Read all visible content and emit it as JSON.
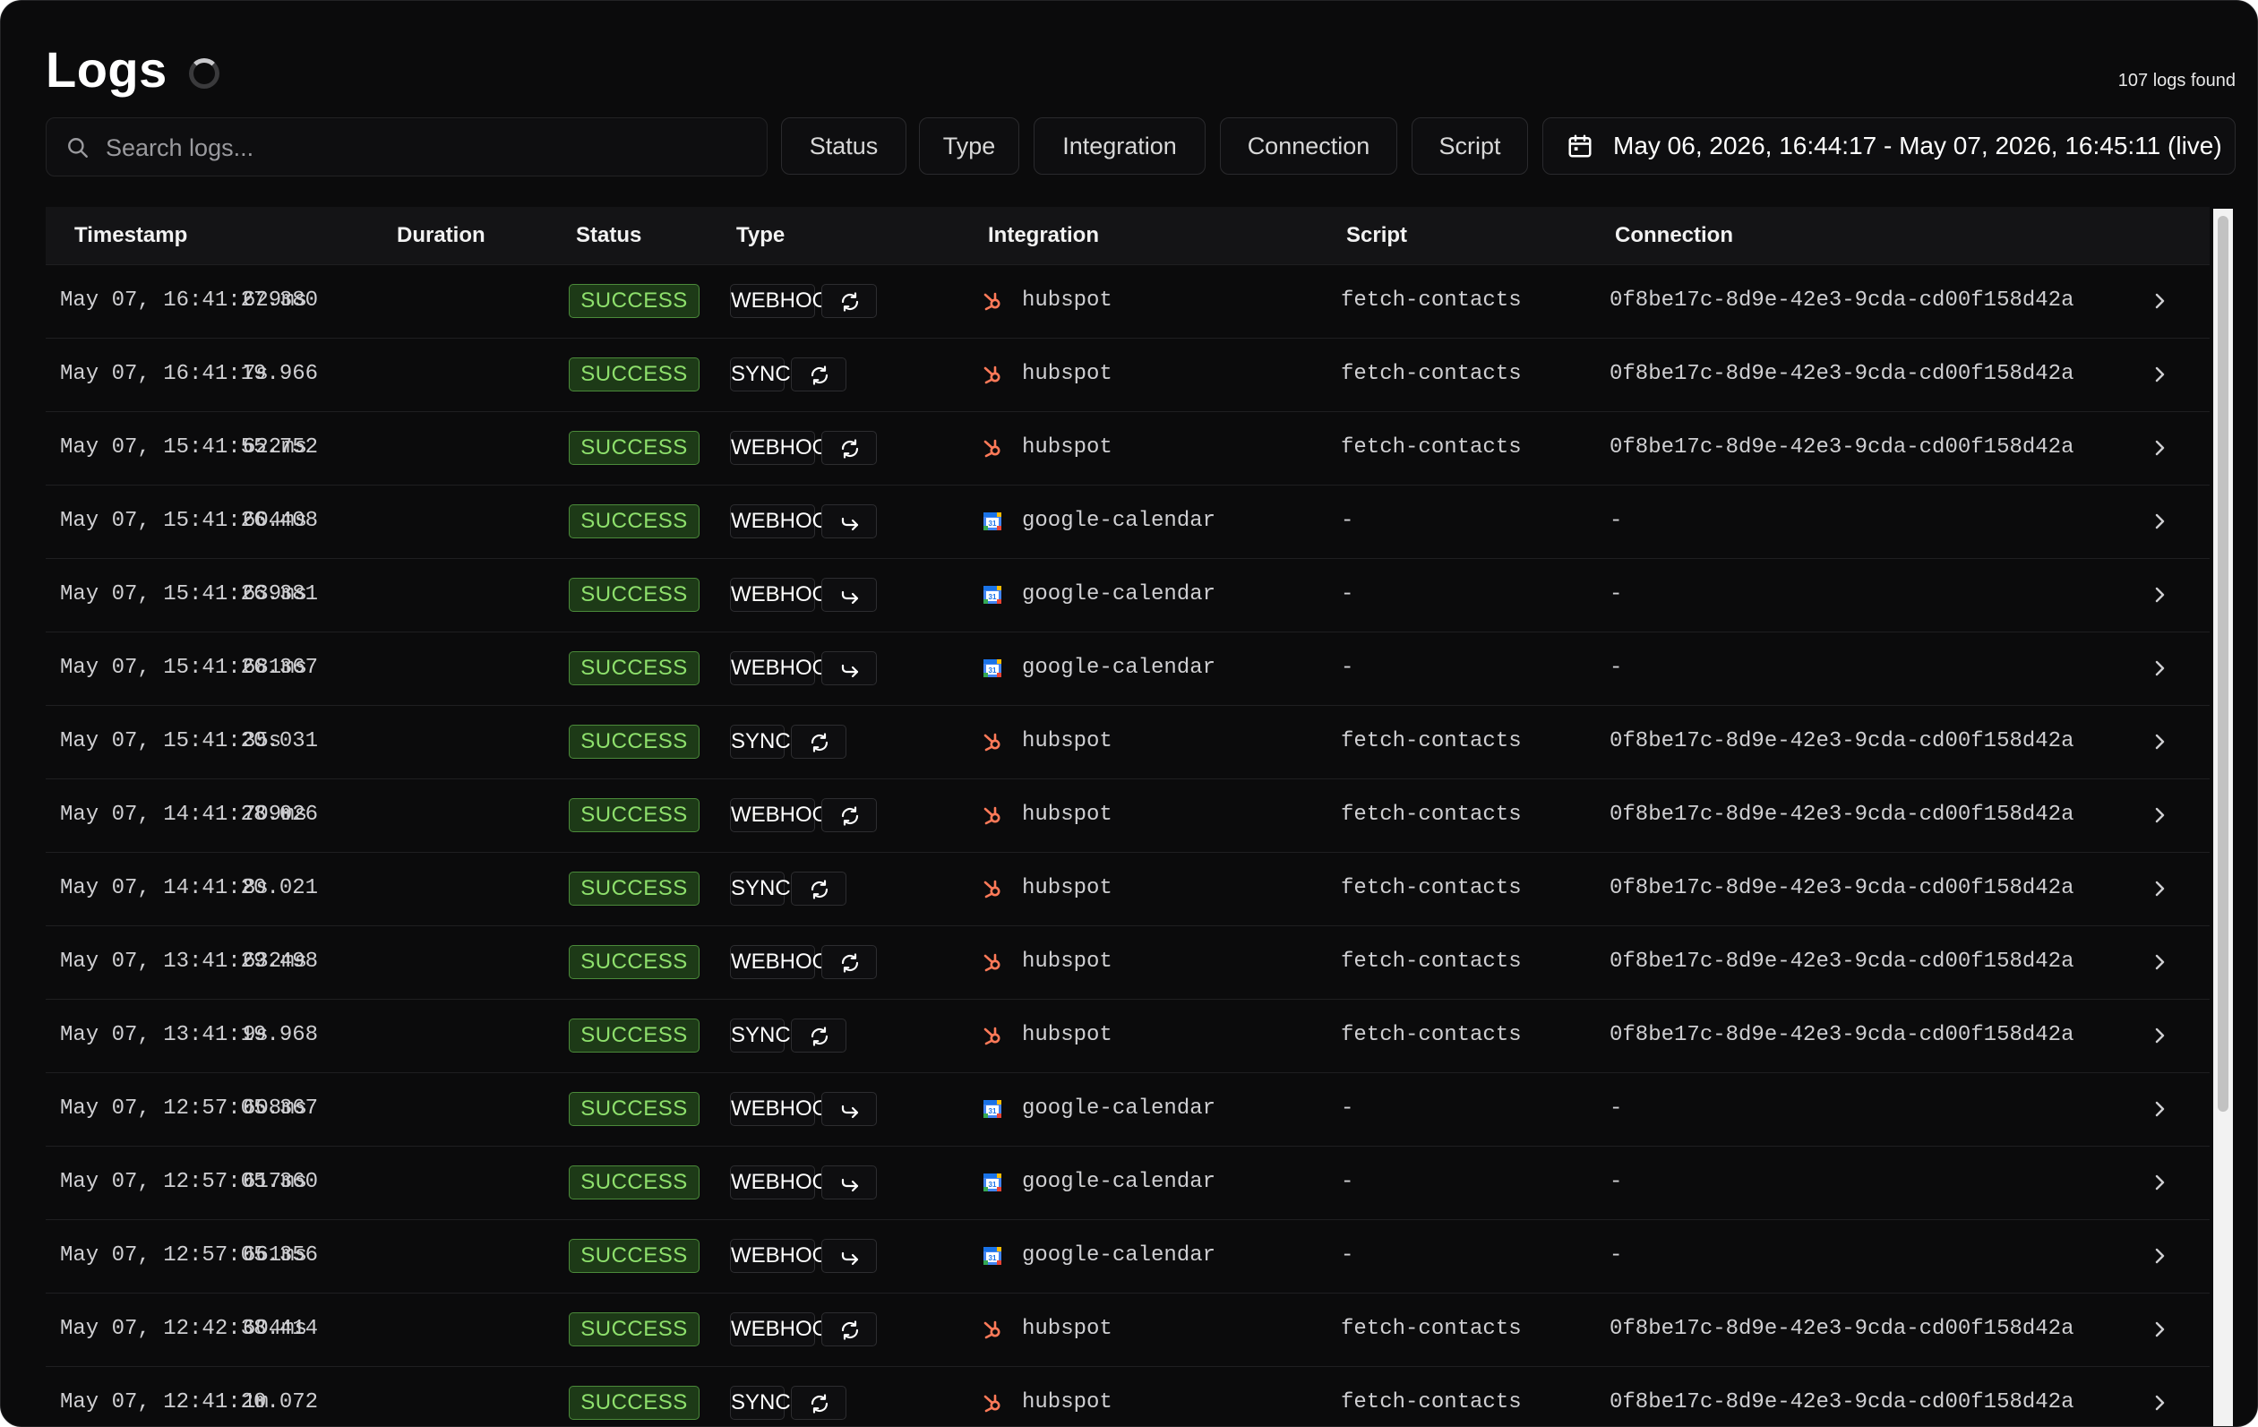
{
  "header": {
    "title": "Logs",
    "count": "107 logs found"
  },
  "search": {
    "placeholder": "Search logs..."
  },
  "filters": [
    {
      "label": "Status"
    },
    {
      "label": "Type"
    },
    {
      "label": "Integration"
    },
    {
      "label": "Connection"
    },
    {
      "label": "Script"
    }
  ],
  "date_range": {
    "label": "May 06, 2026, 16:44:17 - May 07, 2026, 16:45:11 (live)"
  },
  "table": {
    "columns": [
      "Timestamp",
      "Duration",
      "Status",
      "Type",
      "Integration",
      "Script",
      "Connection"
    ],
    "rows": [
      {
        "timestamp": "May 07, 16:41:27.380",
        "duration": "629ms",
        "status": "SUCCESS",
        "type": "WEBHOOK",
        "mode": "sync",
        "integration": "hubspot",
        "script": "fetch-contacts",
        "connection": "0f8be17c-8d9e-42e3-9cda-cd00f158d42a"
      },
      {
        "timestamp": "May 07, 16:41:19.966",
        "duration": "7s",
        "status": "SUCCESS",
        "type": "SYNC",
        "mode": "sync",
        "integration": "hubspot",
        "script": "fetch-contacts",
        "connection": "0f8be17c-8d9e-42e3-9cda-cd00f158d42a"
      },
      {
        "timestamp": "May 07, 15:41:55.752",
        "duration": "622ms",
        "status": "SUCCESS",
        "type": "WEBHOOK",
        "mode": "sync",
        "integration": "hubspot",
        "script": "fetch-contacts",
        "connection": "0f8be17c-8d9e-42e3-9cda-cd00f158d42a"
      },
      {
        "timestamp": "May 07, 15:41:26.408",
        "duration": "604ms",
        "status": "SUCCESS",
        "type": "WEBHOOK",
        "mode": "forward",
        "integration": "google-calendar",
        "script": "-",
        "connection": "-"
      },
      {
        "timestamp": "May 07, 15:41:26.381",
        "duration": "639ms",
        "status": "SUCCESS",
        "type": "WEBHOOK",
        "mode": "forward",
        "integration": "google-calendar",
        "script": "-",
        "connection": "-"
      },
      {
        "timestamp": "May 07, 15:41:26.367",
        "duration": "681ms",
        "status": "SUCCESS",
        "type": "WEBHOOK",
        "mode": "forward",
        "integration": "google-calendar",
        "script": "-",
        "connection": "-"
      },
      {
        "timestamp": "May 07, 15:41:20.031",
        "duration": "35s",
        "status": "SUCCESS",
        "type": "SYNC",
        "mode": "sync",
        "integration": "hubspot",
        "script": "fetch-contacts",
        "connection": "0f8be17c-8d9e-42e3-9cda-cd00f158d42a"
      },
      {
        "timestamp": "May 07, 14:41:28.026",
        "duration": "709ms",
        "status": "SUCCESS",
        "type": "WEBHOOK",
        "mode": "sync",
        "integration": "hubspot",
        "script": "fetch-contacts",
        "connection": "0f8be17c-8d9e-42e3-9cda-cd00f158d42a"
      },
      {
        "timestamp": "May 07, 14:41:20.021",
        "duration": "8s",
        "status": "SUCCESS",
        "type": "SYNC",
        "mode": "sync",
        "integration": "hubspot",
        "script": "fetch-contacts",
        "connection": "0f8be17c-8d9e-42e3-9cda-cd00f158d42a"
      },
      {
        "timestamp": "May 07, 13:41:29.498",
        "duration": "632ms",
        "status": "SUCCESS",
        "type": "WEBHOOK",
        "mode": "sync",
        "integration": "hubspot",
        "script": "fetch-contacts",
        "connection": "0f8be17c-8d9e-42e3-9cda-cd00f158d42a"
      },
      {
        "timestamp": "May 07, 13:41:19.968",
        "duration": "9s",
        "status": "SUCCESS",
        "type": "SYNC",
        "mode": "sync",
        "integration": "hubspot",
        "script": "fetch-contacts",
        "connection": "0f8be17c-8d9e-42e3-9cda-cd00f158d42a"
      },
      {
        "timestamp": "May 07, 12:57:05.367",
        "duration": "608ms",
        "status": "SUCCESS",
        "type": "WEBHOOK",
        "mode": "forward",
        "integration": "google-calendar",
        "script": "-",
        "connection": "-"
      },
      {
        "timestamp": "May 07, 12:57:05.360",
        "duration": "617ms",
        "status": "SUCCESS",
        "type": "WEBHOOK",
        "mode": "forward",
        "integration": "google-calendar",
        "script": "-",
        "connection": "-"
      },
      {
        "timestamp": "May 07, 12:57:05.356",
        "duration": "661ms",
        "status": "SUCCESS",
        "type": "WEBHOOK",
        "mode": "forward",
        "integration": "google-calendar",
        "script": "-",
        "connection": "-"
      },
      {
        "timestamp": "May 07, 12:42:38.414",
        "duration": "604ms",
        "status": "SUCCESS",
        "type": "WEBHOOK",
        "mode": "sync",
        "integration": "hubspot",
        "script": "fetch-contacts",
        "connection": "0f8be17c-8d9e-42e3-9cda-cd00f158d42a"
      },
      {
        "timestamp": "May 07, 12:41:20.072",
        "duration": "1m",
        "status": "SUCCESS",
        "type": "SYNC",
        "mode": "sync",
        "integration": "hubspot",
        "script": "fetch-contacts",
        "connection": "0f8be17c-8d9e-42e3-9cda-cd00f158d42a"
      }
    ]
  },
  "icons": {
    "search": "search-icon",
    "calendar": "calendar-icon",
    "spinner": "loading-spinner-icon",
    "hubspot": "hubspot-icon",
    "google_calendar": "google-calendar-icon",
    "sync": "refresh-icon",
    "forward": "forward-arrow-icon",
    "chevron": "chevron-right-icon"
  },
  "colors": {
    "success_text": "#8ee06c",
    "success_bg": "#1d3a17",
    "hubspot": "#ff7a59"
  }
}
